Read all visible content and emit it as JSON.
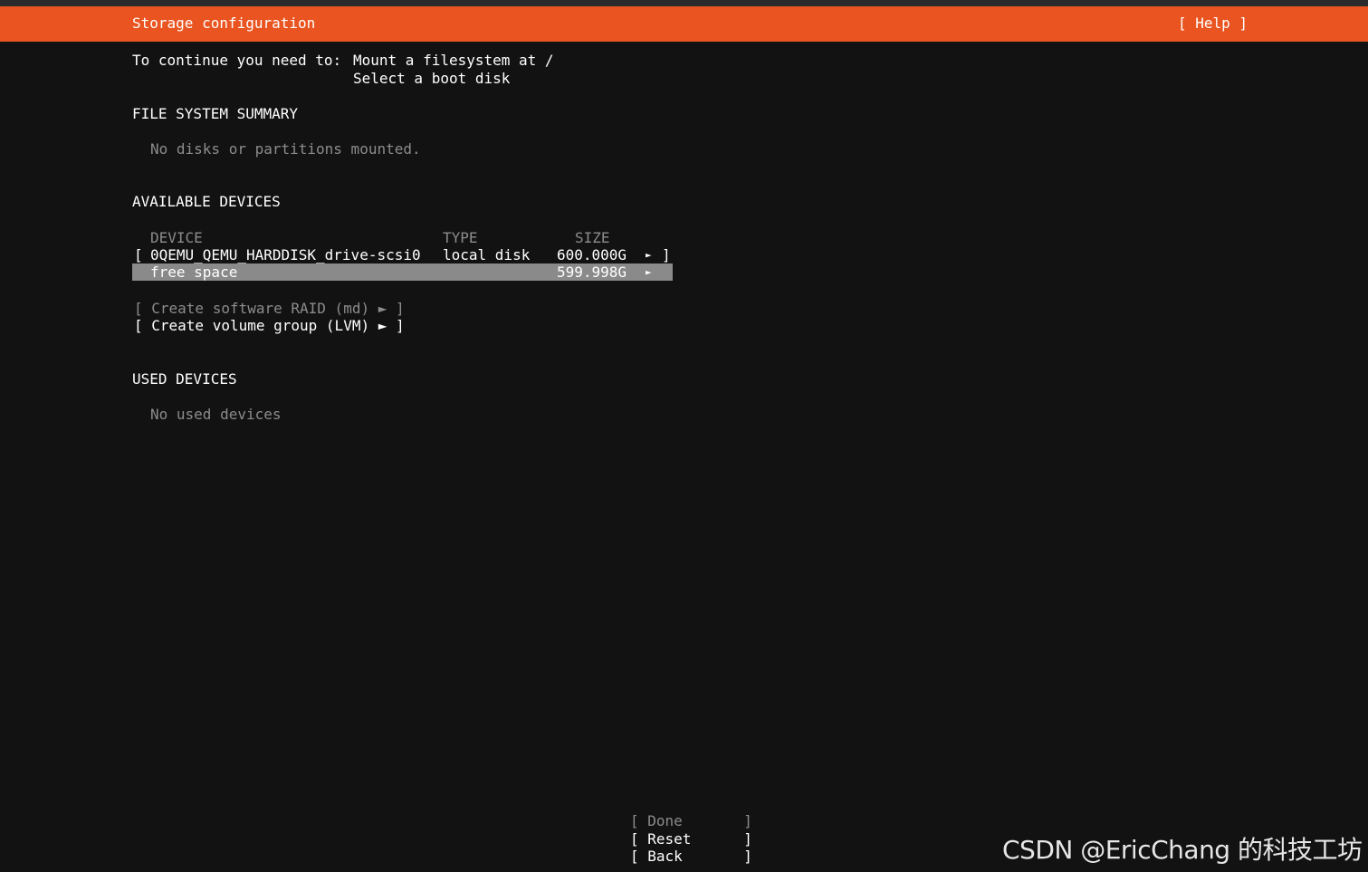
{
  "header": {
    "title": "Storage configuration",
    "help_label": "[ Help ]"
  },
  "requirements": {
    "prefix": "To continue you need to:",
    "items": [
      "Mount a filesystem at /",
      "Select a boot disk"
    ]
  },
  "fs_summary": {
    "heading": "FILE SYSTEM SUMMARY",
    "empty_text": "No disks or partitions mounted."
  },
  "available": {
    "heading": "AVAILABLE DEVICES",
    "columns": [
      "DEVICE",
      "TYPE",
      "SIZE"
    ],
    "devices": [
      {
        "open": "[",
        "name": "0QEMU_QEMU_HARDDISK_drive-scsi0",
        "type": "local disk",
        "size": "600.000G",
        "arrow": "►",
        "close": "]"
      },
      {
        "name": "free space",
        "type": "",
        "size": "599.998G",
        "arrow": "►"
      }
    ],
    "actions": [
      {
        "label": "[ Create software RAID (md) ► ]",
        "enabled": false
      },
      {
        "label": "[ Create volume group (LVM) ► ]",
        "enabled": true
      }
    ]
  },
  "used": {
    "heading": "USED DEVICES",
    "empty_text": "No used devices"
  },
  "footer": {
    "buttons": [
      {
        "label": "[ Done       ]",
        "enabled": false
      },
      {
        "label": "[ Reset      ]",
        "enabled": true
      },
      {
        "label": "[ Back       ]",
        "enabled": true
      }
    ]
  },
  "watermark": "CSDN @EricChang 的科技工坊",
  "colors": {
    "header_bg": "#e95420",
    "background": "#121212",
    "selected_row": "#8a8a8a",
    "disabled_text": "#8c8c8c"
  }
}
